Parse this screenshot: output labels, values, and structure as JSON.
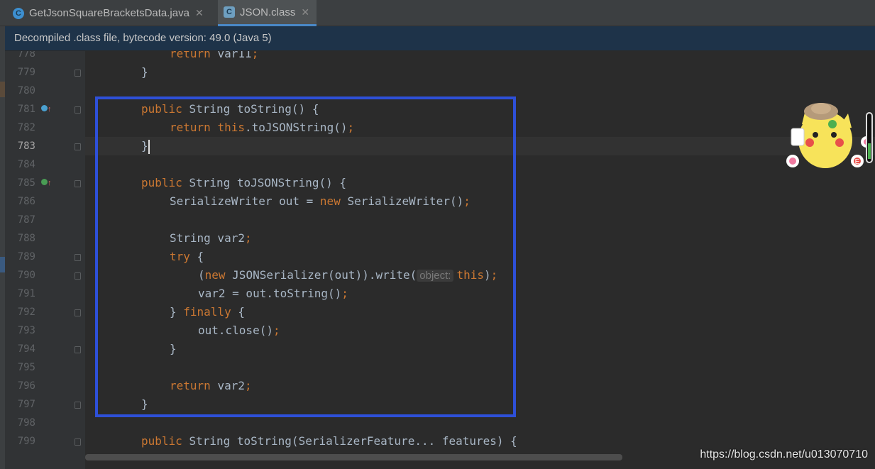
{
  "tabs": [
    {
      "label": "GetJsonSquareBracketsData.java",
      "icon": "java-class-icon",
      "active": false
    },
    {
      "label": "JSON.class",
      "icon": "compiled-class-icon",
      "active": true
    }
  ],
  "infobar": {
    "text": "Decompiled .class file, bytecode version: 49.0 (Java 5)"
  },
  "editor": {
    "current_line": "783",
    "lines": [
      {
        "num": "778",
        "indent": 2,
        "tokens": [
          {
            "t": "return ",
            "c": "kw"
          },
          {
            "t": "var11",
            "c": "id"
          },
          {
            "t": ";",
            "c": "kw"
          }
        ]
      },
      {
        "num": "779",
        "indent": 1,
        "tokens": [
          {
            "t": "}",
            "c": "id"
          }
        ]
      },
      {
        "num": "780",
        "indent": 0,
        "tokens": []
      },
      {
        "num": "781",
        "indent": 1,
        "tokens": [
          {
            "t": "public ",
            "c": "kw"
          },
          {
            "t": "String toString() {",
            "c": "id"
          }
        ]
      },
      {
        "num": "782",
        "indent": 2,
        "tokens": [
          {
            "t": "return ",
            "c": "kw"
          },
          {
            "t": "this",
            "c": "kw"
          },
          {
            "t": ".toJSONString()",
            "c": "id"
          },
          {
            "t": ";",
            "c": "kw"
          }
        ]
      },
      {
        "num": "783",
        "indent": 1,
        "tokens": [
          {
            "t": "}",
            "c": "id"
          }
        ]
      },
      {
        "num": "784",
        "indent": 0,
        "tokens": []
      },
      {
        "num": "785",
        "indent": 1,
        "tokens": [
          {
            "t": "public ",
            "c": "kw"
          },
          {
            "t": "String toJSONString() {",
            "c": "id"
          }
        ]
      },
      {
        "num": "786",
        "indent": 2,
        "tokens": [
          {
            "t": "SerializeWriter out = ",
            "c": "id"
          },
          {
            "t": "new ",
            "c": "kw"
          },
          {
            "t": "SerializeWriter()",
            "c": "id"
          },
          {
            "t": ";",
            "c": "kw"
          }
        ]
      },
      {
        "num": "787",
        "indent": 0,
        "tokens": []
      },
      {
        "num": "788",
        "indent": 2,
        "tokens": [
          {
            "t": "String var2",
            "c": "id"
          },
          {
            "t": ";",
            "c": "kw"
          }
        ]
      },
      {
        "num": "789",
        "indent": 2,
        "tokens": [
          {
            "t": "try ",
            "c": "kw"
          },
          {
            "t": "{",
            "c": "id"
          }
        ]
      },
      {
        "num": "790",
        "indent": 3,
        "tokens": [
          {
            "t": "(",
            "c": "id"
          },
          {
            "t": "new ",
            "c": "kw"
          },
          {
            "t": "JSONSerializer(out)).write(",
            "c": "id"
          },
          {
            "t": "object:",
            "c": "hint"
          },
          {
            "t": "this",
            "c": "kw"
          },
          {
            "t": ")",
            "c": "id"
          },
          {
            "t": ";",
            "c": "kw"
          }
        ]
      },
      {
        "num": "791",
        "indent": 3,
        "tokens": [
          {
            "t": "var2 = out.toString()",
            "c": "id"
          },
          {
            "t": ";",
            "c": "kw"
          }
        ]
      },
      {
        "num": "792",
        "indent": 2,
        "tokens": [
          {
            "t": "} ",
            "c": "id"
          },
          {
            "t": "finally ",
            "c": "kw"
          },
          {
            "t": "{",
            "c": "id"
          }
        ]
      },
      {
        "num": "793",
        "indent": 3,
        "tokens": [
          {
            "t": "out.close()",
            "c": "id"
          },
          {
            "t": ";",
            "c": "kw"
          }
        ]
      },
      {
        "num": "794",
        "indent": 2,
        "tokens": [
          {
            "t": "}",
            "c": "id"
          }
        ]
      },
      {
        "num": "795",
        "indent": 0,
        "tokens": []
      },
      {
        "num": "796",
        "indent": 2,
        "tokens": [
          {
            "t": "return ",
            "c": "kw"
          },
          {
            "t": "var2",
            "c": "id"
          },
          {
            "t": ";",
            "c": "kw"
          }
        ]
      },
      {
        "num": "797",
        "indent": 1,
        "tokens": [
          {
            "t": "}",
            "c": "id"
          }
        ]
      },
      {
        "num": "798",
        "indent": 0,
        "tokens": []
      },
      {
        "num": "799",
        "indent": 1,
        "tokens": [
          {
            "t": "public ",
            "c": "kw"
          },
          {
            "t": "String toString(SerializerFeature... features) {",
            "c": "id"
          }
        ]
      }
    ],
    "fold_lines": [
      "779",
      "781",
      "783",
      "785",
      "789",
      "790",
      "792",
      "794",
      "797",
      "799"
    ],
    "gutter_icons": [
      {
        "line": "781",
        "icon": "override-method-icon",
        "color": "#4aa0d0"
      },
      {
        "line": "785",
        "icon": "implement-method-icon",
        "color": "#499c54"
      }
    ]
  },
  "colors": {
    "keyword": "#cc7832",
    "identifier": "#a9b7c6",
    "highlight_box": "#2e50d8",
    "info_bar": "#1e3349"
  },
  "watermark": "https://blog.csdn.net/u013070710"
}
